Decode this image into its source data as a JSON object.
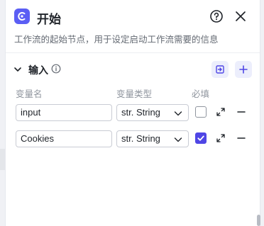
{
  "node": {
    "title": "开始",
    "description": "工作流的起始节点，用于设定启动工作流需要的信息"
  },
  "section": {
    "title": "输入"
  },
  "columns": {
    "name": "变量名",
    "type": "变量类型",
    "required": "必填"
  },
  "inputs": [
    {
      "name": "input",
      "type": "str. String",
      "required": false
    },
    {
      "name": "Cookies",
      "type": "str. String",
      "required": true
    }
  ],
  "colors": {
    "accent": "#5b5ef4",
    "checked": "#4f46e5",
    "muted_text": "#8f959e"
  },
  "icons": {
    "node": "workflow-start-icon",
    "help": "help-circle-icon",
    "close": "close-icon",
    "collapse": "chevron-down-icon",
    "info": "info-icon",
    "import": "import-variable-icon",
    "add": "plus-icon",
    "expand": "expand-arrows-icon",
    "remove": "minus-icon"
  }
}
